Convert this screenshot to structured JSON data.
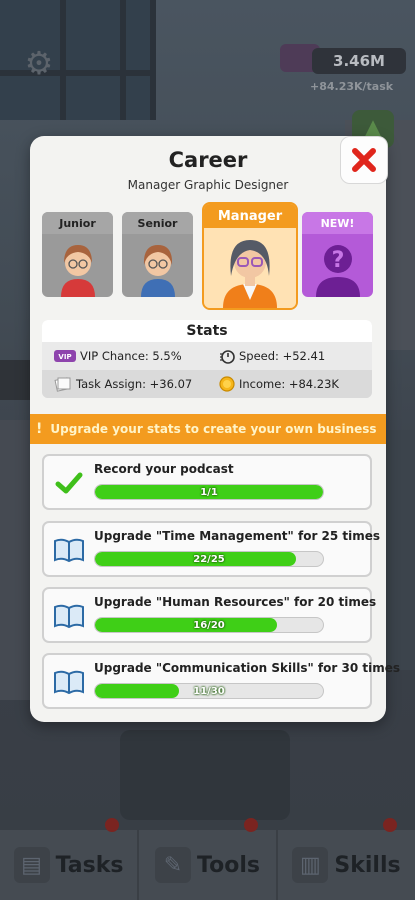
{
  "hud": {
    "money": "3.46M",
    "rate": "+84.23K/task"
  },
  "modal": {
    "title": "Career",
    "subtitle": "Manager Graphic Designer",
    "cards": [
      {
        "label": "Junior",
        "progress_state": "locked-past"
      },
      {
        "label": "Senior",
        "progress_state": "locked-past"
      },
      {
        "label": "Manager",
        "progress_state": "current"
      },
      {
        "label": "NEW!",
        "progress_state": "next"
      }
    ],
    "stats": {
      "title": "Stats",
      "vip_chance": "VIP Chance: 5.5%",
      "speed": "Speed: +52.41",
      "task_assign": "Task Assign: +36.07",
      "income": "Income: +84.23K"
    },
    "banner": "Upgrade your stats to create your own business",
    "tasks": [
      {
        "label": "Record your podcast",
        "progress_text": "1/1",
        "current": 1,
        "total": 1,
        "icon": "check-icon"
      },
      {
        "label": "Upgrade \"Time Management\" for 25 times",
        "progress_text": "22/25",
        "current": 22,
        "total": 25,
        "icon": "book-icon"
      },
      {
        "label": "Upgrade \"Human Resources\" for 20 times",
        "progress_text": "16/20",
        "current": 16,
        "total": 20,
        "icon": "book-icon"
      },
      {
        "label": "Upgrade \"Communication Skills\" for 30 times",
        "progress_text": "11/30",
        "current": 11,
        "total": 30,
        "icon": "book-icon"
      }
    ]
  },
  "tabs": [
    {
      "label": "Tasks",
      "icon": "newspaper-icon"
    },
    {
      "label": "Tools",
      "icon": "tools-icon"
    },
    {
      "label": "Skills",
      "icon": "book-icon"
    }
  ],
  "colors": {
    "accent_orange": "#f39b1f",
    "progress_green": "#3fcf17",
    "close_red": "#e0261c",
    "new_purple": "#b45ad8"
  }
}
